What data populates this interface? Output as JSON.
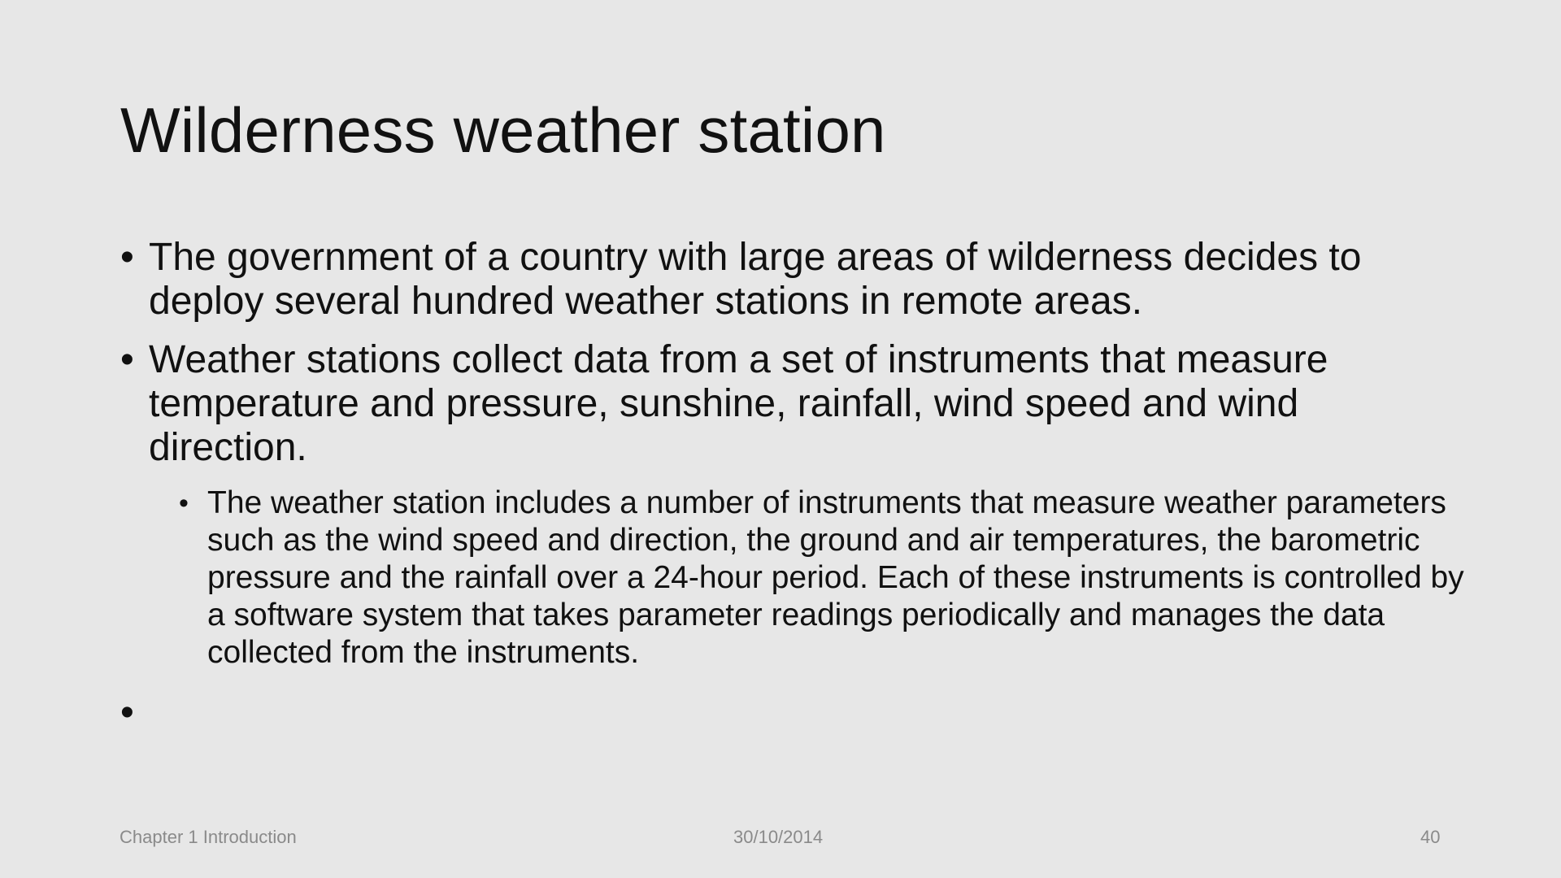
{
  "slide": {
    "title": "Wilderness weather station",
    "bullets": [
      {
        "marker": "•",
        "text": "The government of a country with large areas of wilderness decides to deploy several hundred weather stations in remote areas."
      },
      {
        "marker": "•",
        "text": "Weather stations collect data from a set of instruments that measure temperature and pressure, sunshine, rainfall, wind speed and wind direction."
      }
    ],
    "sub_bullets": [
      {
        "marker": "•",
        "text": "The weather station includes a number of instruments that measure weather parameters such as the wind speed and direction, the ground and air temperatures, the barometric pressure and the rainfall over a 24-hour period. Each of these instruments is controlled by a software system that takes parameter readings periodically and manages the data collected from the instruments."
      }
    ],
    "empty_bullet": "•"
  },
  "footer": {
    "left": "Chapter 1 Introduction",
    "center": "30/10/2014",
    "right": "40"
  }
}
